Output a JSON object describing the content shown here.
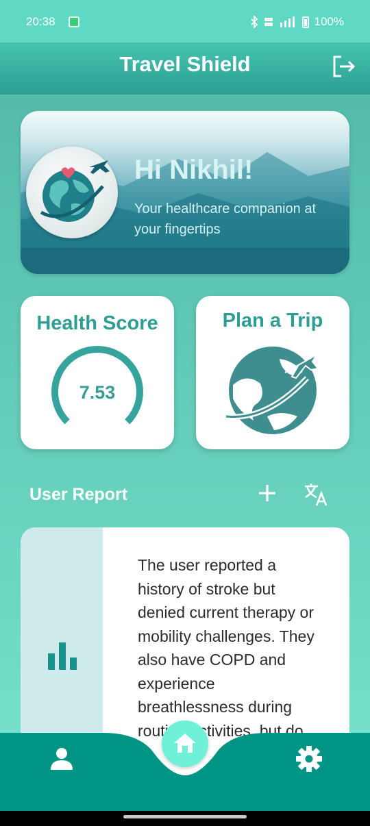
{
  "status_bar": {
    "time": "20:38",
    "battery": "100%",
    "icons": [
      "bluetooth-icon",
      "volte-icon",
      "5g-signal-icon",
      "battery-icon"
    ]
  },
  "app_bar": {
    "title": "Travel Shield",
    "logout_icon": "logout-icon"
  },
  "hero": {
    "greeting": "Hi Nikhil!",
    "subtitle": "Your healthcare companion at your fingertips",
    "logo": "globe-plane-heart-logo"
  },
  "health_score": {
    "title": "Health Score",
    "value": "7.53",
    "gauge_fraction": 0.75
  },
  "plan_trip": {
    "title": "Plan a Trip",
    "icon": "globe-plane-icon"
  },
  "user_report": {
    "heading": "User Report",
    "add_icon": "plus-icon",
    "translate_icon": "translate-icon",
    "chart_icon": "bar-chart-icon",
    "text": "The user reported a history of stroke but denied current therapy or mobility challenges. They also have COPD and experience breathlessness during routine activities, but do"
  },
  "bottom_nav": {
    "items": [
      "person-icon",
      "home-icon",
      "gear-icon"
    ]
  },
  "colors": {
    "accent": "#2e9e94",
    "nav_bar": "#009485",
    "home_button": "#6ff0d9",
    "report_side": "#cfeaea"
  }
}
